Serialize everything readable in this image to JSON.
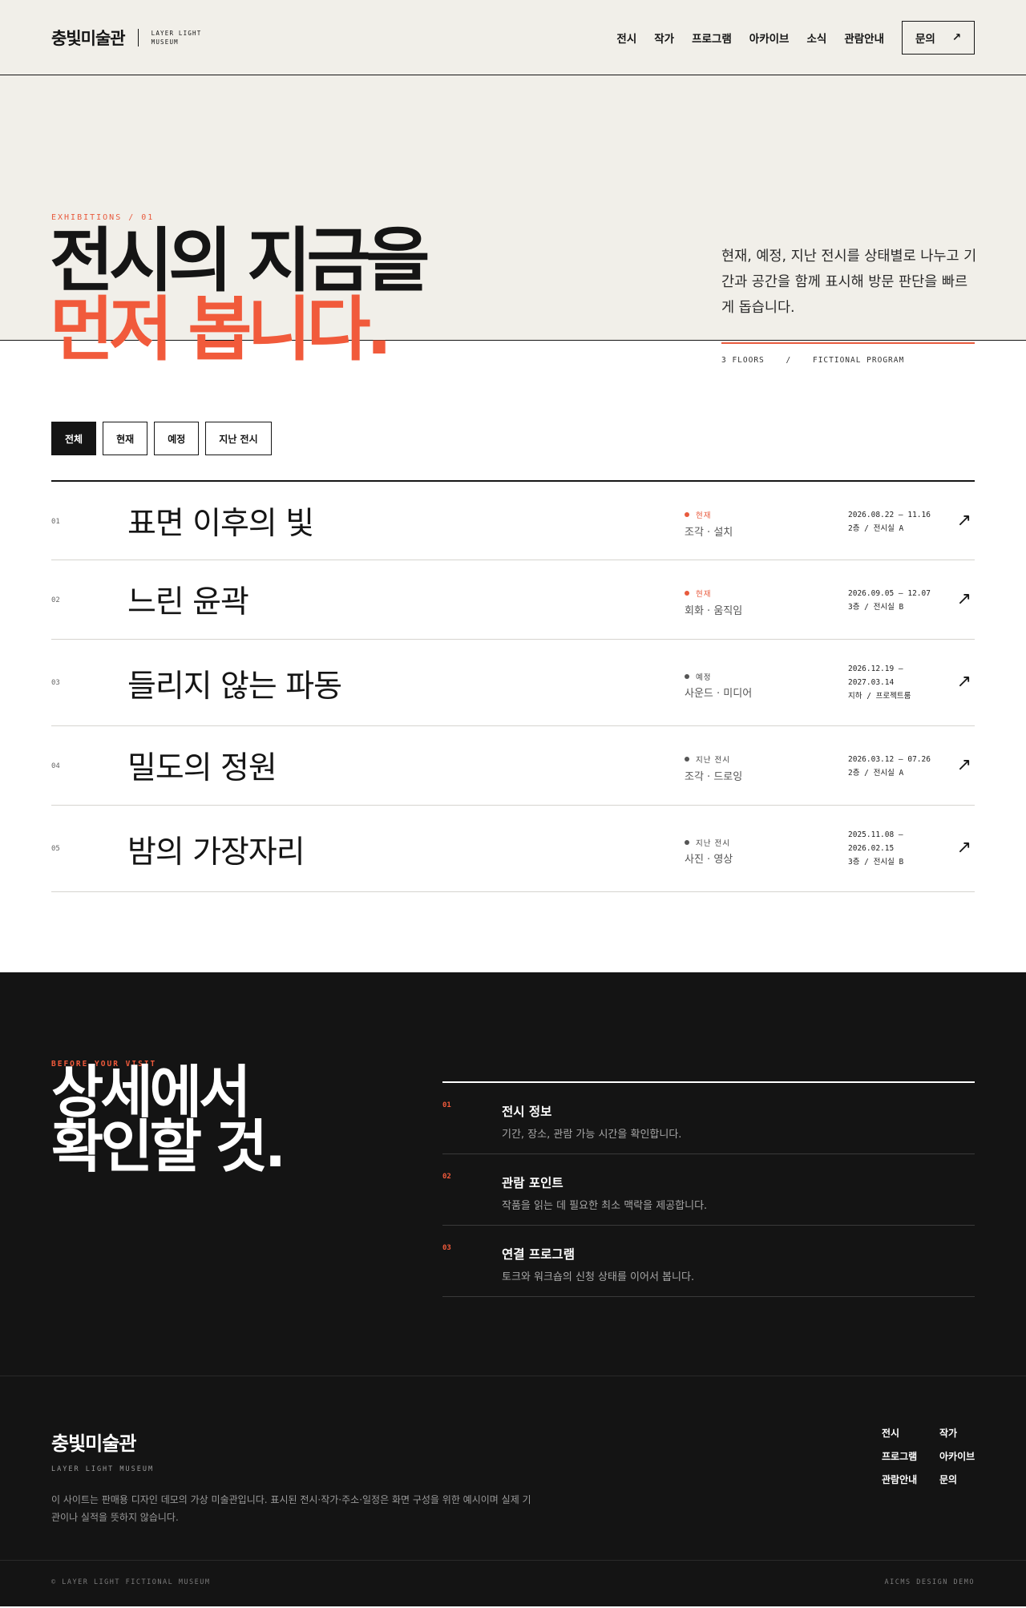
{
  "header": {
    "logo_kr": "충빛미술관",
    "logo_en": "LAYER LIGHT MUSEUM",
    "nav": [
      "전시",
      "작가",
      "프로그램",
      "아카이브",
      "소식",
      "관람안내"
    ],
    "cta_label": "문의",
    "cta_icon": "arrow-up-right-icon"
  },
  "hero": {
    "eyebrow": "EXHIBITIONS / 01",
    "title_line1": "전시의 지금을",
    "title_line2": "먼저 봅니다.",
    "description": "현재, 예정, 지난 전시를 상태별로 나누고 기간과 공간을 함께 표시해 방문 판단을 빠르게 돕습니다.",
    "meta": [
      "3 FLOORS",
      "/",
      "FICTIONAL PROGRAM"
    ],
    "accent_color": "#f15a3b"
  },
  "filters": {
    "items": [
      "전체",
      "현재",
      "예정",
      "지난 전시"
    ],
    "selected": "전체"
  },
  "exhibitions": [
    {
      "num": "01",
      "title": "표면 이후의 빛",
      "status": "현재",
      "status_color": "#e85a3d",
      "category": "조각 · 설치",
      "date_line1": "2026.08.22 — 11.16",
      "date_line2": "2층 / 전시실 A",
      "date_line3": ""
    },
    {
      "num": "02",
      "title": "느린 윤곽",
      "status": "현재",
      "status_color": "#e85a3d",
      "category": "회화 · 움직임",
      "date_line1": "2026.09.05 — 12.07",
      "date_line2": "3층 / 전시실 B",
      "date_line3": ""
    },
    {
      "num": "03",
      "title": "들리지 않는 파동",
      "status": "예정",
      "status_color": "#555555",
      "category": "사운드 · 미디어",
      "date_line1": "2026.12.19 —",
      "date_line2": "2027.03.14",
      "date_line3": "지하 / 프로젝트룸"
    },
    {
      "num": "04",
      "title": "밀도의 정원",
      "status": "지난 전시",
      "status_color": "#555555",
      "category": "조각 · 드로잉",
      "date_line1": "2026.03.12 — 07.26",
      "date_line2": "2층 / 전시실 A",
      "date_line3": ""
    },
    {
      "num": "05",
      "title": "밤의 가장자리",
      "status": "지난 전시",
      "status_color": "#555555",
      "category": "사진 · 영상",
      "date_line1": "2025.11.08 —",
      "date_line2": "2026.02.15",
      "date_line3": "3층 / 전시실 B"
    }
  ],
  "visit": {
    "eyebrow": "BEFORE YOUR VISIT",
    "title_line1": "상세에서",
    "title_line2": "확인할 것.",
    "steps": [
      {
        "num": "01",
        "title": "전시 정보",
        "desc": "기간, 장소, 관람 가능 시간을 확인합니다."
      },
      {
        "num": "02",
        "title": "관람 포인트",
        "desc": "작품을 읽는 데 필요한 최소 맥락을 제공합니다."
      },
      {
        "num": "03",
        "title": "연결 프로그램",
        "desc": "토크와 워크숍의 신청 상태를 이어서 봅니다."
      }
    ]
  },
  "footer": {
    "logo_kr": "충빛미술관",
    "logo_en": "LAYER LIGHT MUSEUM",
    "note": "이 사이트는 판매용 디자인 데모의 가상 미술관입니다. 표시된 전시·작가·주소·일정은 화면 구성을 위한 예시이며 실제 기관이나 실적을 뜻하지 않습니다.",
    "links": [
      "전시",
      "작가",
      "프로그램",
      "아카이브",
      "관람안내",
      "문의"
    ],
    "bottom_left": "© LAYER LIGHT FICTIONAL MUSEUM",
    "bottom_right": "AICMS DESIGN DEMO"
  }
}
